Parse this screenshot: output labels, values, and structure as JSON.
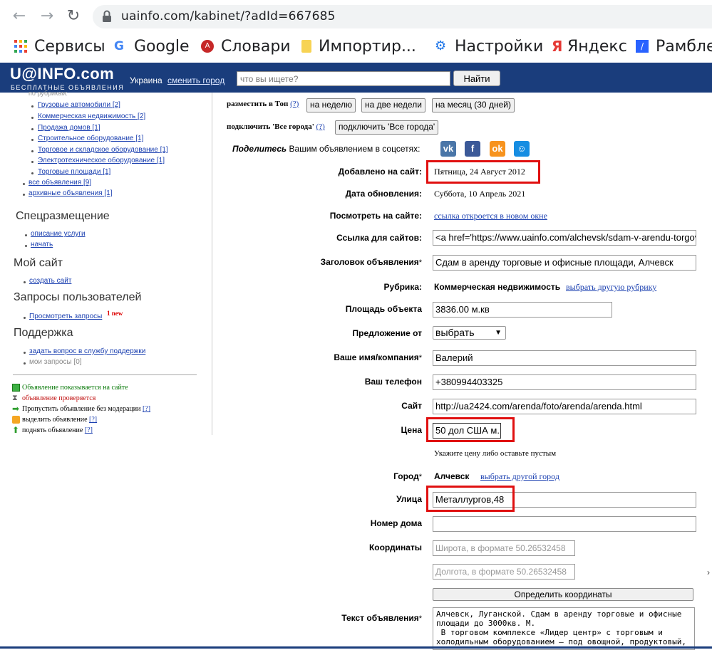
{
  "browser": {
    "url": "uainfo.com/kabinet/?adId=667685",
    "bookmarks": [
      "Сервисы",
      "Google",
      "Словари",
      "Импортир...",
      "Настройки",
      "Яндекс",
      "Рамбле"
    ]
  },
  "header": {
    "logo": "U@INFO.com",
    "logo_sub": "БЕСПЛАТНЫЕ ОБЪЯВЛЕНИЯ",
    "region": "Украина",
    "change_city": "сменить город",
    "search_placeholder": "что вы ищете?",
    "search_button": "Найти"
  },
  "sidebar": {
    "cut_heading": "по рубрикам:",
    "rubrics": [
      {
        "label": "Грузовые автомобили",
        "count": "[2]"
      },
      {
        "label": "Коммерческая недвижимость",
        "count": "[2]"
      },
      {
        "label": "Продажа домов",
        "count": "[1]"
      },
      {
        "label": "Строительное оборудование",
        "count": "[1]"
      },
      {
        "label": "Торговое и складское оборудование",
        "count": "[1]"
      },
      {
        "label": "Электротехническое оборудование",
        "count": "[1]"
      },
      {
        "label": "Торговые площади",
        "count": "[1]"
      }
    ],
    "all_ads": {
      "label": "все объявления",
      "count": "[9]"
    },
    "archive_ads": {
      "label": "архивные объявления",
      "count": "[1]"
    },
    "special_heading": "Спецразмещение",
    "special_links": [
      "описание услуги",
      "начать"
    ],
    "mysite_heading": "Мой сайт",
    "mysite_link": "создать сайт",
    "requests_heading": "Запросы пользователей",
    "requests_link": "Просмотреть запросы",
    "requests_new": "1 new",
    "support_heading": "Поддержка",
    "support_link": "задать вопрос в службу поддержки",
    "my_requests": "мои запросы [0]",
    "legend": [
      {
        "text": "Объявление показывается на сайте",
        "color": "#0a7a0a",
        "q": ""
      },
      {
        "text": "объявление проверяется",
        "color": "#c01010",
        "q": ""
      },
      {
        "text": "Пропустить объявление без модерации",
        "color": "#000000",
        "q": "[?]"
      },
      {
        "text": "выделить объявление",
        "color": "#000000",
        "q": "[?]"
      },
      {
        "text": "поднять объявление",
        "color": "#000000",
        "q": "[?]"
      }
    ]
  },
  "form": {
    "top_label": "разместить в Топ",
    "top_q": "(?)",
    "top_buttons": [
      "на неделю",
      "на две недели",
      "на месяц (30 дней)"
    ],
    "all_cities_label": "подключить 'Все города'",
    "all_cities_q": "(?)",
    "all_cities_button": "подключить 'Все города'",
    "share_italic": "Поделитесь",
    "share_rest": "Вашим объявлением в соцсетях:",
    "added_label": "Добавлено на сайт:",
    "added_value": "Пятница, 24 Август 2012",
    "updated_label": "Дата обновления:",
    "updated_value": "Суббота, 10 Апрель 2021",
    "view_label": "Посмотреть на сайте:",
    "view_link": "ссылка откроется в новом окне",
    "link_label": "Ссылка для сайтов:",
    "link_value": "<a href='https://www.uainfo.com/alchevsk/sdam-v-arendu-torgovye",
    "title_label": "Заголовок объявления",
    "title_value": "Сдам в аренду торговые и офисные площади, Алчевск",
    "rubric_label": "Рубрика:",
    "rubric_value": "Коммерческая недвижимость",
    "rubric_link": "выбрать другую рубрику",
    "area_label": "Площадь объекта",
    "area_value": "3836.00 м.кв",
    "offer_label": "Предложение от",
    "offer_value": "выбрать",
    "name_label": "Ваше имя/компания",
    "name_value": "Валерий",
    "phone_label": "Ваш телефон",
    "phone_value": "+380994403325",
    "site_label": "Сайт",
    "site_value": "http://ua2424.com/arenda/foto/arenda/arenda.html",
    "price_label": "Цена",
    "price_value": "50 дол США м.",
    "price_hint": "Укажите цену либо оставьте пустым",
    "city_label": "Город",
    "city_value": "Алчевск",
    "city_link": "выбрать другой город",
    "street_label": "Улица",
    "street_value": "Металлургов,48",
    "house_label": "Номер дома",
    "coords_label": "Координаты",
    "lat_placeholder": "Широта, в формате 50.26532458",
    "lon_placeholder": "Долгота, в формате 50.26532458",
    "coords_button": "Определить координаты",
    "text_label": "Текст объявления",
    "text_value": "Алчевск, Луганской. Сдам в аренду торговые и офисные\nплощади до 3000кв. М.\n В торговом комплексе «Лидер центр» с торговым и\nхолодильным оборудованием – под овощной, продуктовый,",
    "star": "*"
  },
  "colors": {
    "header_bg": "#1a3d7c",
    "link": "#1a3fb0",
    "highlight": "#e01010"
  }
}
